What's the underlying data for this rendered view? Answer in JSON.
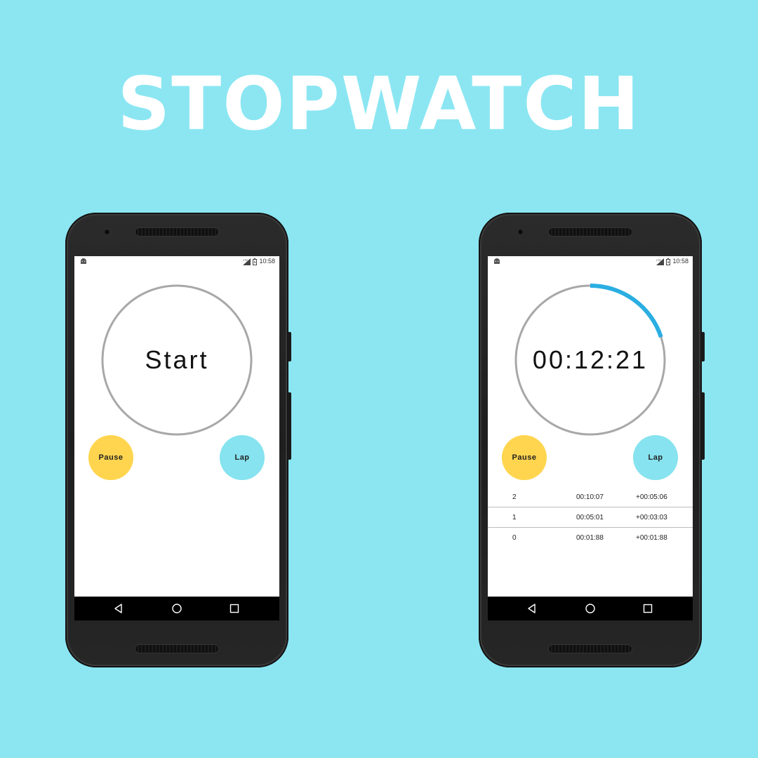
{
  "banner": {
    "title": "STOPWATCH"
  },
  "colors": {
    "background": "#8be6f2",
    "pause_button": "#ffd54f",
    "lap_button": "#86e3ef",
    "progress_arc": "#2aaee2",
    "dial_ring": "#a8a8a8"
  },
  "phones": [
    {
      "status": {
        "network": "LTE",
        "time": "10:58"
      },
      "dial": {
        "text": "Start",
        "progress": 0
      },
      "buttons": {
        "pause": "Pause",
        "lap": "Lap"
      },
      "laps": []
    },
    {
      "status": {
        "network": "LTE",
        "time": "10:58"
      },
      "dial": {
        "text": "00:12:21",
        "progress": 0.2
      },
      "buttons": {
        "pause": "Pause",
        "lap": "Lap"
      },
      "laps": [
        {
          "number": "2",
          "total": "00:10:07",
          "split": "+00:05:06"
        },
        {
          "number": "1",
          "total": "00:05:01",
          "split": "+00:03:03"
        },
        {
          "number": "0",
          "total": "00:01:88",
          "split": "+00:01:88"
        }
      ]
    }
  ],
  "icons": {
    "status_left": "android-icon",
    "signal": "signal-icon",
    "battery": "battery-icon",
    "nav": [
      "back-icon",
      "home-icon",
      "recent-apps-icon"
    ]
  }
}
